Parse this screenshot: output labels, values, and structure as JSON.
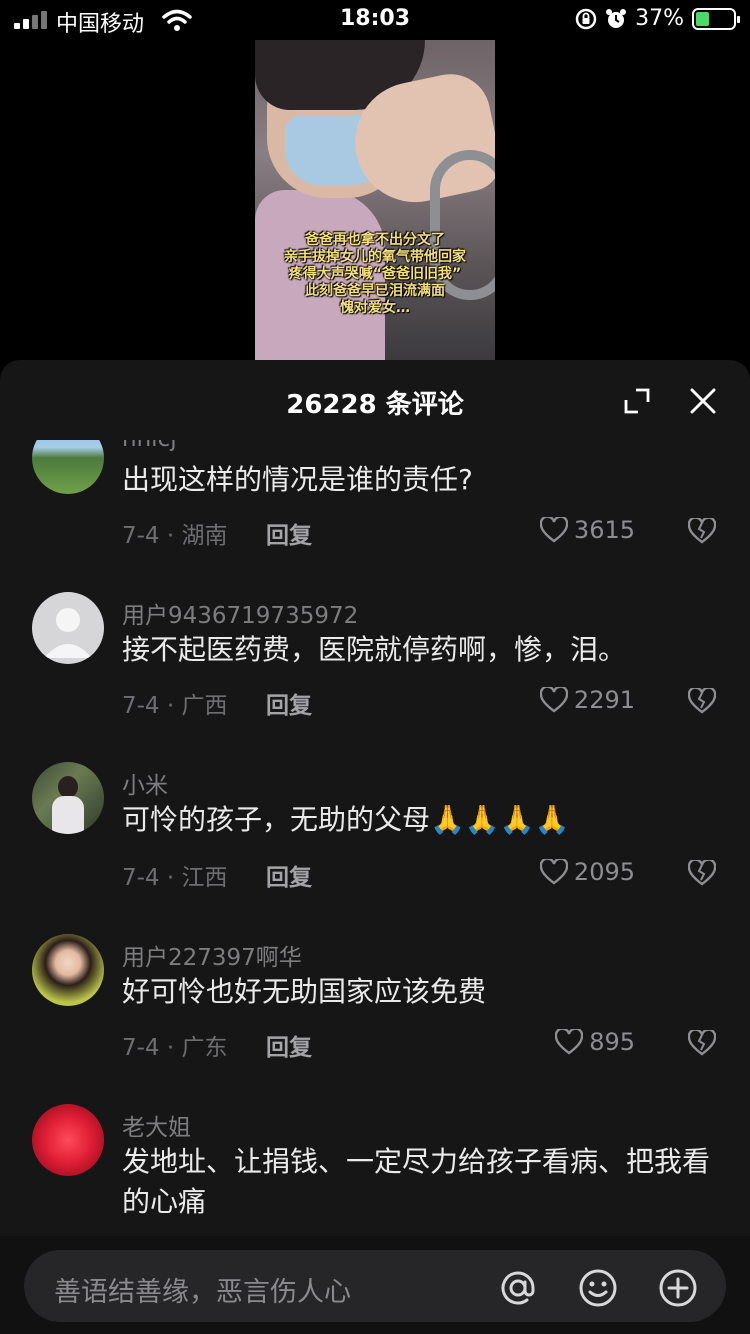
{
  "status_bar": {
    "carrier": "中国移动",
    "time": "18:03",
    "battery": "37%",
    "battery_level": 0.37
  },
  "video": {
    "caption_lines": [
      "爸爸再也拿不出分文了",
      "亲手拔掉女儿的氧气带他回家",
      "疼得大声哭喊“爸爸旧旧我”",
      "此刻爸爸早已泪流满面",
      "愧对爱女…"
    ]
  },
  "sheet": {
    "title": "26228 条评论",
    "icons": [
      "expand-icon",
      "close-icon"
    ]
  },
  "comments": [
    {
      "user": "nnicj",
      "text": "出现这样的情况是谁的责任?",
      "date_loc": "7-4 · 湖南",
      "reply": "回复",
      "likes": "3615"
    },
    {
      "user": "用户9436719735972",
      "text": "接不起医药费，医院就停药啊，惨，泪。",
      "date_loc": "7-4 · 广西",
      "reply": "回复",
      "likes": "2291"
    },
    {
      "user": "小米",
      "text": "可怜的孩子，无助的父母🙏🙏🙏🙏",
      "date_loc": "7-4 · 江西",
      "reply": "回复",
      "likes": "2095"
    },
    {
      "user": "用户227397啊华",
      "text": "好可怜也好无助国家应该免费",
      "date_loc": "7-4 · 广东",
      "reply": "回复",
      "likes": "895"
    },
    {
      "user": "老大姐",
      "text": "发地址、让捐钱、一定尽力给孩子看病、把我看的心痛",
      "date_loc": "",
      "reply": "",
      "likes": ""
    }
  ],
  "input": {
    "placeholder": "善语结善缘，恶言伤人心",
    "icons": [
      "at-icon",
      "emoji-icon",
      "plus-icon"
    ]
  },
  "colors": {
    "sheet_bg": "#161617",
    "battery_green": "#4cd964",
    "caption_yellow": "#f5e07a"
  }
}
